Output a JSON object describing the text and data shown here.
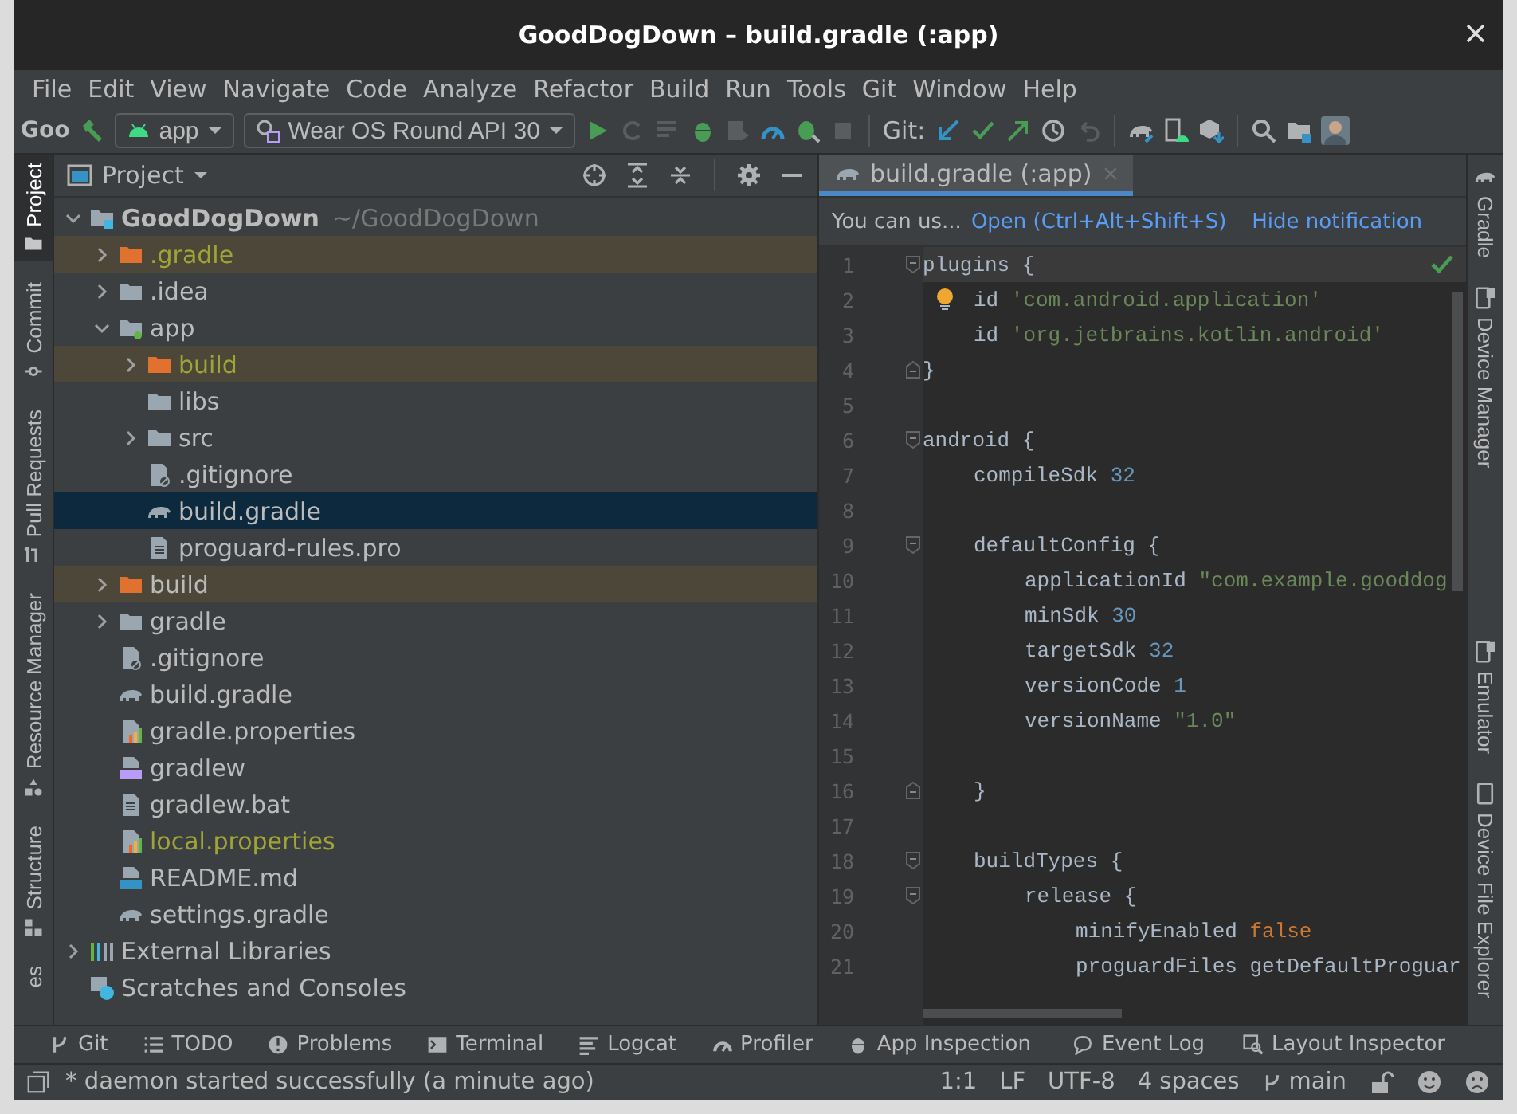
{
  "window": {
    "title": "GoodDogDown – build.gradle (:app)"
  },
  "menu": [
    "File",
    "Edit",
    "View",
    "Navigate",
    "Code",
    "Analyze",
    "Refactor",
    "Build",
    "Run",
    "Tools",
    "Git",
    "Window",
    "Help"
  ],
  "toolbar": {
    "project": "Goo",
    "configuration": "app",
    "device": "Wear OS Round API 30",
    "git_label": "Git:"
  },
  "left_tool_windows": [
    {
      "label": "Project",
      "kind": "project",
      "selected": true
    },
    {
      "label": "Commit",
      "kind": "commit",
      "selected": false
    },
    {
      "label": "Pull Requests",
      "kind": "pull-requests",
      "selected": false
    },
    {
      "label": "Resource Manager",
      "kind": "resources",
      "selected": false
    },
    {
      "label": "Structure",
      "kind": "structure",
      "selected": false
    },
    {
      "label": "es",
      "kind": "plain",
      "selected": false
    }
  ],
  "right_tool_windows": {
    "top": [
      {
        "label": "Gradle",
        "kind": "gradle",
        "selected": false
      },
      {
        "label": "Device Manager",
        "kind": "device",
        "selected": false
      }
    ],
    "bottom": [
      {
        "label": "Emulator",
        "kind": "device",
        "selected": false
      },
      {
        "label": "Device File Explorer",
        "kind": "phone",
        "selected": false
      }
    ]
  },
  "project_panel": {
    "title": "Project",
    "tree": [
      {
        "name": "GoodDogDown",
        "path": "~/GoodDogDown",
        "kind": "root",
        "expanded": true,
        "selected": false,
        "excluded": false,
        "ignored": false,
        "children": [
          {
            "name": ".gradle",
            "kind": "folder",
            "expanded": false,
            "selected": false,
            "excluded": true,
            "ignored": true
          },
          {
            "name": ".idea",
            "kind": "folder",
            "expanded": false,
            "selected": false,
            "excluded": false,
            "ignored": false
          },
          {
            "name": "app",
            "kind": "module",
            "expanded": true,
            "selected": false,
            "excluded": false,
            "ignored": false,
            "children": [
              {
                "name": "build",
                "kind": "folder",
                "expanded": false,
                "selected": false,
                "excluded": true,
                "ignored": true
              },
              {
                "name": "libs",
                "kind": "folder-leaf",
                "selected": false,
                "excluded": false,
                "ignored": false
              },
              {
                "name": "src",
                "kind": "folder",
                "expanded": false,
                "selected": false,
                "excluded": false,
                "ignored": false
              },
              {
                "name": ".gitignore",
                "kind": "ignore",
                "selected": false,
                "excluded": false,
                "ignored": false
              },
              {
                "name": "build.gradle",
                "kind": "gradle",
                "selected": true,
                "excluded": false,
                "ignored": false
              },
              {
                "name": "proguard-rules.pro",
                "kind": "text",
                "selected": false,
                "excluded": false,
                "ignored": false
              }
            ]
          },
          {
            "name": "build",
            "kind": "folder",
            "expanded": false,
            "selected": false,
            "excluded": true,
            "ignored": false
          },
          {
            "name": "gradle",
            "kind": "folder",
            "expanded": false,
            "selected": false,
            "excluded": false,
            "ignored": false
          },
          {
            "name": ".gitignore",
            "kind": "ignore",
            "selected": false,
            "excluded": false,
            "ignored": false
          },
          {
            "name": "build.gradle",
            "kind": "gradle",
            "selected": false,
            "excluded": false,
            "ignored": false
          },
          {
            "name": "gradle.properties",
            "kind": "properties",
            "selected": false,
            "excluded": false,
            "ignored": false
          },
          {
            "name": "gradlew",
            "kind": "script",
            "selected": false,
            "excluded": false,
            "ignored": false
          },
          {
            "name": "gradlew.bat",
            "kind": "text",
            "selected": false,
            "excluded": false,
            "ignored": false
          },
          {
            "name": "local.properties",
            "kind": "properties",
            "selected": false,
            "excluded": false,
            "ignored": true
          },
          {
            "name": "README.md",
            "kind": "markdown",
            "selected": false,
            "excluded": false,
            "ignored": false
          },
          {
            "name": "settings.gradle",
            "kind": "gradle",
            "selected": false,
            "excluded": false,
            "ignored": false
          }
        ]
      },
      {
        "name": "External Libraries",
        "kind": "libraries",
        "expanded": false,
        "selected": false,
        "excluded": false,
        "ignored": false
      },
      {
        "name": "Scratches and Consoles",
        "kind": "scratches",
        "selected": false,
        "excluded": false,
        "ignored": false
      }
    ]
  },
  "editor": {
    "tab": {
      "label": "build.gradle (:app)",
      "selected": true
    },
    "notification": {
      "text": "You can us...",
      "actions": [
        "Open (Ctrl+Alt+Shift+S)",
        "Hide notification"
      ]
    },
    "lines": [
      {
        "number": "1",
        "current": true,
        "bulb": false,
        "fold_open": true,
        "fold_close": false,
        "tokens": [
          {
            "text": "plugins {",
            "kind": "plain"
          }
        ],
        "children": [
          {
            "number": "2",
            "current": false,
            "bulb": true,
            "fold_open": false,
            "fold_close": false,
            "tokens": [
              {
                "text": "id ",
                "kind": "plain"
              },
              {
                "text": "'com.android.application'",
                "kind": "string"
              }
            ]
          },
          {
            "number": "3",
            "current": false,
            "bulb": false,
            "fold_open": false,
            "fold_close": false,
            "tokens": [
              {
                "text": "id ",
                "kind": "plain"
              },
              {
                "text": "'org.jetbrains.kotlin.android'",
                "kind": "string"
              }
            ]
          }
        ]
      },
      {
        "number": "4",
        "current": false,
        "bulb": false,
        "fold_open": false,
        "fold_close": true,
        "tokens": [
          {
            "text": "}",
            "kind": "plain"
          }
        ]
      },
      {
        "number": "5",
        "current": false,
        "bulb": false,
        "fold_open": false,
        "fold_close": false
      },
      {
        "number": "6",
        "current": false,
        "bulb": false,
        "fold_open": true,
        "fold_close": false,
        "tokens": [
          {
            "text": "android {",
            "kind": "plain"
          }
        ],
        "children": [
          {
            "number": "7",
            "current": false,
            "bulb": false,
            "fold_open": false,
            "fold_close": false,
            "tokens": [
              {
                "text": "compileSdk ",
                "kind": "plain"
              },
              {
                "text": "32",
                "kind": "number"
              }
            ]
          },
          {
            "number": "8",
            "current": false,
            "bulb": false,
            "fold_open": false,
            "fold_close": false
          },
          {
            "number": "9",
            "current": false,
            "bulb": false,
            "fold_open": true,
            "fold_close": false,
            "tokens": [
              {
                "text": "defaultConfig {",
                "kind": "plain"
              }
            ],
            "children": [
              {
                "number": "10",
                "current": false,
                "bulb": false,
                "fold_open": false,
                "fold_close": false,
                "tokens": [
                  {
                    "text": "applicationId ",
                    "kind": "plain"
                  },
                  {
                    "text": "\"com.example.gooddog",
                    "kind": "string"
                  }
                ]
              },
              {
                "number": "11",
                "current": false,
                "bulb": false,
                "fold_open": false,
                "fold_close": false,
                "tokens": [
                  {
                    "text": "minSdk ",
                    "kind": "plain"
                  },
                  {
                    "text": "30",
                    "kind": "number"
                  }
                ]
              },
              {
                "number": "12",
                "current": false,
                "bulb": false,
                "fold_open": false,
                "fold_close": false,
                "tokens": [
                  {
                    "text": "targetSdk ",
                    "kind": "plain"
                  },
                  {
                    "text": "32",
                    "kind": "number"
                  }
                ]
              },
              {
                "number": "13",
                "current": false,
                "bulb": false,
                "fold_open": false,
                "fold_close": false,
                "tokens": [
                  {
                    "text": "versionCode ",
                    "kind": "plain"
                  },
                  {
                    "text": "1",
                    "kind": "number"
                  }
                ]
              },
              {
                "number": "14",
                "current": false,
                "bulb": false,
                "fold_open": false,
                "fold_close": false,
                "tokens": [
                  {
                    "text": "versionName ",
                    "kind": "plain"
                  },
                  {
                    "text": "\"1.0\"",
                    "kind": "string"
                  }
                ]
              },
              {
                "number": "15",
                "current": false,
                "bulb": false,
                "fold_open": false,
                "fold_close": false
              }
            ]
          },
          {
            "number": "16",
            "current": false,
            "bulb": false,
            "fold_open": false,
            "fold_close": true,
            "tokens": [
              {
                "text": "}",
                "kind": "plain"
              }
            ]
          },
          {
            "number": "17",
            "current": false,
            "bulb": false,
            "fold_open": false,
            "fold_close": false
          },
          {
            "number": "18",
            "current": false,
            "bulb": false,
            "fold_open": true,
            "fold_close": false,
            "tokens": [
              {
                "text": "buildTypes {",
                "kind": "plain"
              }
            ],
            "children": [
              {
                "number": "19",
                "current": false,
                "bulb": false,
                "fold_open": true,
                "fold_close": false,
                "tokens": [
                  {
                    "text": "release {",
                    "kind": "plain"
                  }
                ],
                "children": [
                  {
                    "number": "20",
                    "current": false,
                    "bulb": false,
                    "fold_open": false,
                    "fold_close": false,
                    "tokens": [
                      {
                        "text": "minifyEnabled ",
                        "kind": "plain"
                      },
                      {
                        "text": "false",
                        "kind": "keyword"
                      }
                    ]
                  },
                  {
                    "number": "21",
                    "current": false,
                    "bulb": false,
                    "fold_open": false,
                    "fold_close": false,
                    "tokens": [
                      {
                        "text": "proguardFiles getDefaultProguar",
                        "kind": "plain"
                      }
                    ]
                  }
                ]
              }
            ]
          }
        ]
      }
    ]
  },
  "bottom_tools": {
    "left": [
      {
        "label": "Git",
        "kind": "git"
      },
      {
        "label": "TODO",
        "kind": "list"
      },
      {
        "label": "Problems",
        "kind": "problems"
      },
      {
        "label": "Terminal",
        "kind": "terminal"
      },
      {
        "label": "Logcat",
        "kind": "log"
      },
      {
        "label": "Profiler",
        "kind": "gauge"
      },
      {
        "label": "App Inspection",
        "kind": "inspect"
      }
    ],
    "right": [
      {
        "label": "Event Log",
        "kind": "bubble"
      },
      {
        "label": "Layout Inspector",
        "kind": "inspect-layout"
      }
    ]
  },
  "status_bar": {
    "message": "* daemon started successfully (a minute ago)",
    "position": "1:1",
    "line_separator": "LF",
    "encoding": "UTF-8",
    "indent": "4 spaces",
    "branch": "main"
  }
}
